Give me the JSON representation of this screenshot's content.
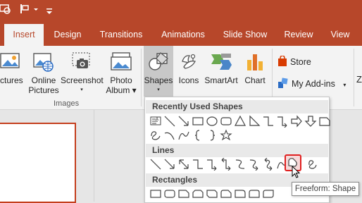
{
  "ribbon_tabs": [
    {
      "label": "Insert",
      "active": true
    },
    {
      "label": "Design"
    },
    {
      "label": "Transitions"
    },
    {
      "label": "Animations"
    },
    {
      "label": "Slide Show"
    },
    {
      "label": "Review"
    },
    {
      "label": "View"
    }
  ],
  "ribbon": {
    "pictures_label": "ictures",
    "online_pictures": [
      "Online",
      "Pictures"
    ],
    "screenshot": [
      "Screenshot",
      "▾"
    ],
    "photo_album": [
      "Photo",
      "Album ▾"
    ],
    "images_group": "Images",
    "shapes": [
      "Shapes",
      "▾"
    ],
    "icons": "Icons",
    "smartart": "SmartArt",
    "chart": "Chart",
    "store": "Store",
    "my_addins": "My Add-ins",
    "my_addins_caret": "▾",
    "partial_right": "Z"
  },
  "shapes_menu": {
    "recent_header": "Recently Used Shapes",
    "lines_header": "Lines",
    "rect_header": "Rectangles"
  },
  "tooltip": "Freeform: Shape",
  "colors": {
    "title_bar": "#b7472a",
    "ribbon_bg": "#f3f3f3",
    "accent": "#c43e1c",
    "highlight_border": "#e02020"
  }
}
